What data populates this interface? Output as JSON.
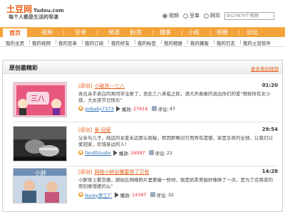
{
  "header": {
    "logo_cn": "土豆网",
    "logo_en": "Tudou.com",
    "slogan": "每个人都是生活的导演",
    "search_options": [
      {
        "label": "视频",
        "selected": true
      },
      {
        "label": "豆单",
        "selected": false
      },
      {
        "label": "网页",
        "selected": false
      }
    ],
    "search_placeholder": "9527670个视频"
  },
  "nav": {
    "items": [
      "首页",
      "视频",
      "豆单",
      "频道",
      "标签",
      "播客",
      "小组",
      "相册",
      "论坛"
    ],
    "active": "首页",
    "accent_color": "#f4a23a"
  },
  "subnav": {
    "items": [
      "我的主页",
      "我的视频",
      "我的豆单",
      "我的订阅",
      "我的好友",
      "我的标签",
      "我的相册",
      "我的播客",
      "我的日志",
      "我的土豆软件"
    ]
  },
  "panel": {
    "title": "原创最精彩",
    "more_label": "更多原创视频",
    "items": [
      {
        "tag": "[原创]",
        "title": "小破孩---三八",
        "duration": "01:20",
        "description": "各位亲手表白的男同学注意了，至此三八来临之际，请大声勇敢的说出你们的爱\"预祝所有女小孩，大女孩节日快乐\"",
        "author": "pobaby7373",
        "play_label": "播放:",
        "plays": "27616",
        "comment_label": "评论:",
        "comments": "47"
      },
      {
        "tag": "[原创]",
        "title": "爱 回家",
        "duration": "29:54",
        "description": "父亲与儿子，疏远的关爱永远那么隐秘，即因即略对方而寄有遗憾，家是生命的全部，让我们以爱回家，珍惜身边的人！",
        "author": "fandfstudio",
        "play_label": "播放:",
        "plays": "16097",
        "comment_label": "评论:",
        "comments": "21"
      },
      {
        "tag": "[原创]",
        "title": "网络小胖自曝要举了贝有",
        "duration": "14:28",
        "description": "小胖穿上繁衣服，跟拍比网络照片里要瘦一些呀，倒是奶茶美眉好像胖了一点，是为了应吞菜的而刻意增肥的么\"",
        "author": "Rocky梦工厂",
        "play_label": "播放:",
        "plays": "14397",
        "comment_label": "评论:",
        "comments": "32"
      }
    ]
  }
}
